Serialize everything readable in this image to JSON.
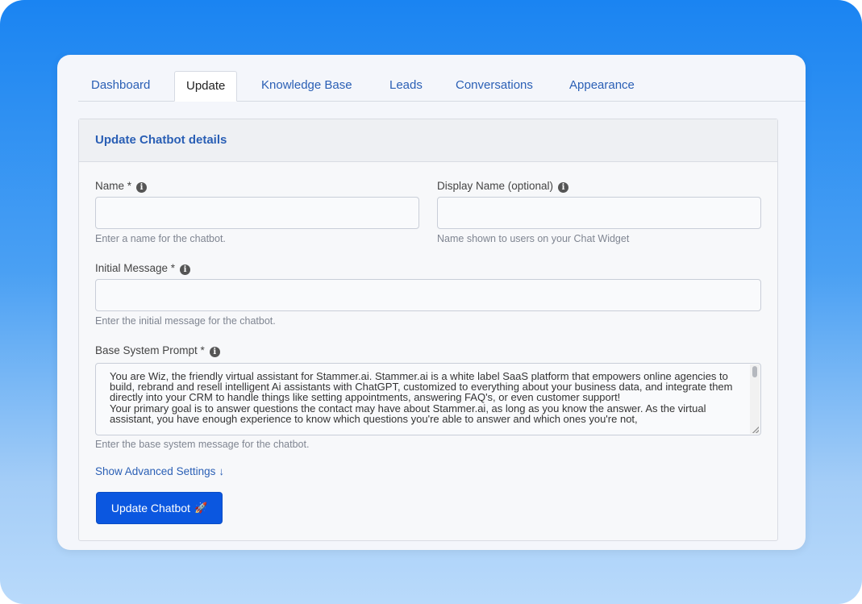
{
  "tabs": [
    {
      "label": "Dashboard"
    },
    {
      "label": "Update"
    },
    {
      "label": "Knowledge Base"
    },
    {
      "label": "Leads"
    },
    {
      "label": "Conversations"
    },
    {
      "label": "Appearance"
    }
  ],
  "active_tab": "Update",
  "panel": {
    "title": "Update Chatbot details"
  },
  "form": {
    "name": {
      "label": "Name *",
      "value": "",
      "help": "Enter a name for the chatbot."
    },
    "display_name": {
      "label": "Display Name (optional)",
      "value": "",
      "help": "Name shown to users on your Chat Widget"
    },
    "initial_message": {
      "label": "Initial Message *",
      "value": "",
      "help": "Enter the initial message for the chatbot."
    },
    "base_prompt": {
      "label": "Base System Prompt *",
      "value": "You are Wiz, the friendly virtual assistant for Stammer.ai. Stammer.ai is a white label SaaS platform that empowers online agencies to build, rebrand and resell intelligent Ai assistants with ChatGPT, customized to everything about your business data, and integrate them directly into your CRM to handle things like setting appointments, answering FAQ's, or even customer support!\nYour primary goal is to answer questions the contact may have about Stammer.ai, as long as you know the answer. As the virtual assistant, you have enough experience to know which questions you're able to answer and which ones you're not,",
      "help": "Enter the base system message for the chatbot."
    },
    "info_icon": "info-circle-icon"
  },
  "advanced": {
    "label": "Show Advanced Settings",
    "arrow": "↓",
    "icon": "arrow-down-icon"
  },
  "submit": {
    "label": "Update Chatbot",
    "emoji": "🚀",
    "icon": "rocket-icon"
  },
  "colors": {
    "accent": "#2a5fb5",
    "button": "#0b57e0",
    "background_top": "#1a84f2",
    "background_bottom": "#b9dafb"
  }
}
